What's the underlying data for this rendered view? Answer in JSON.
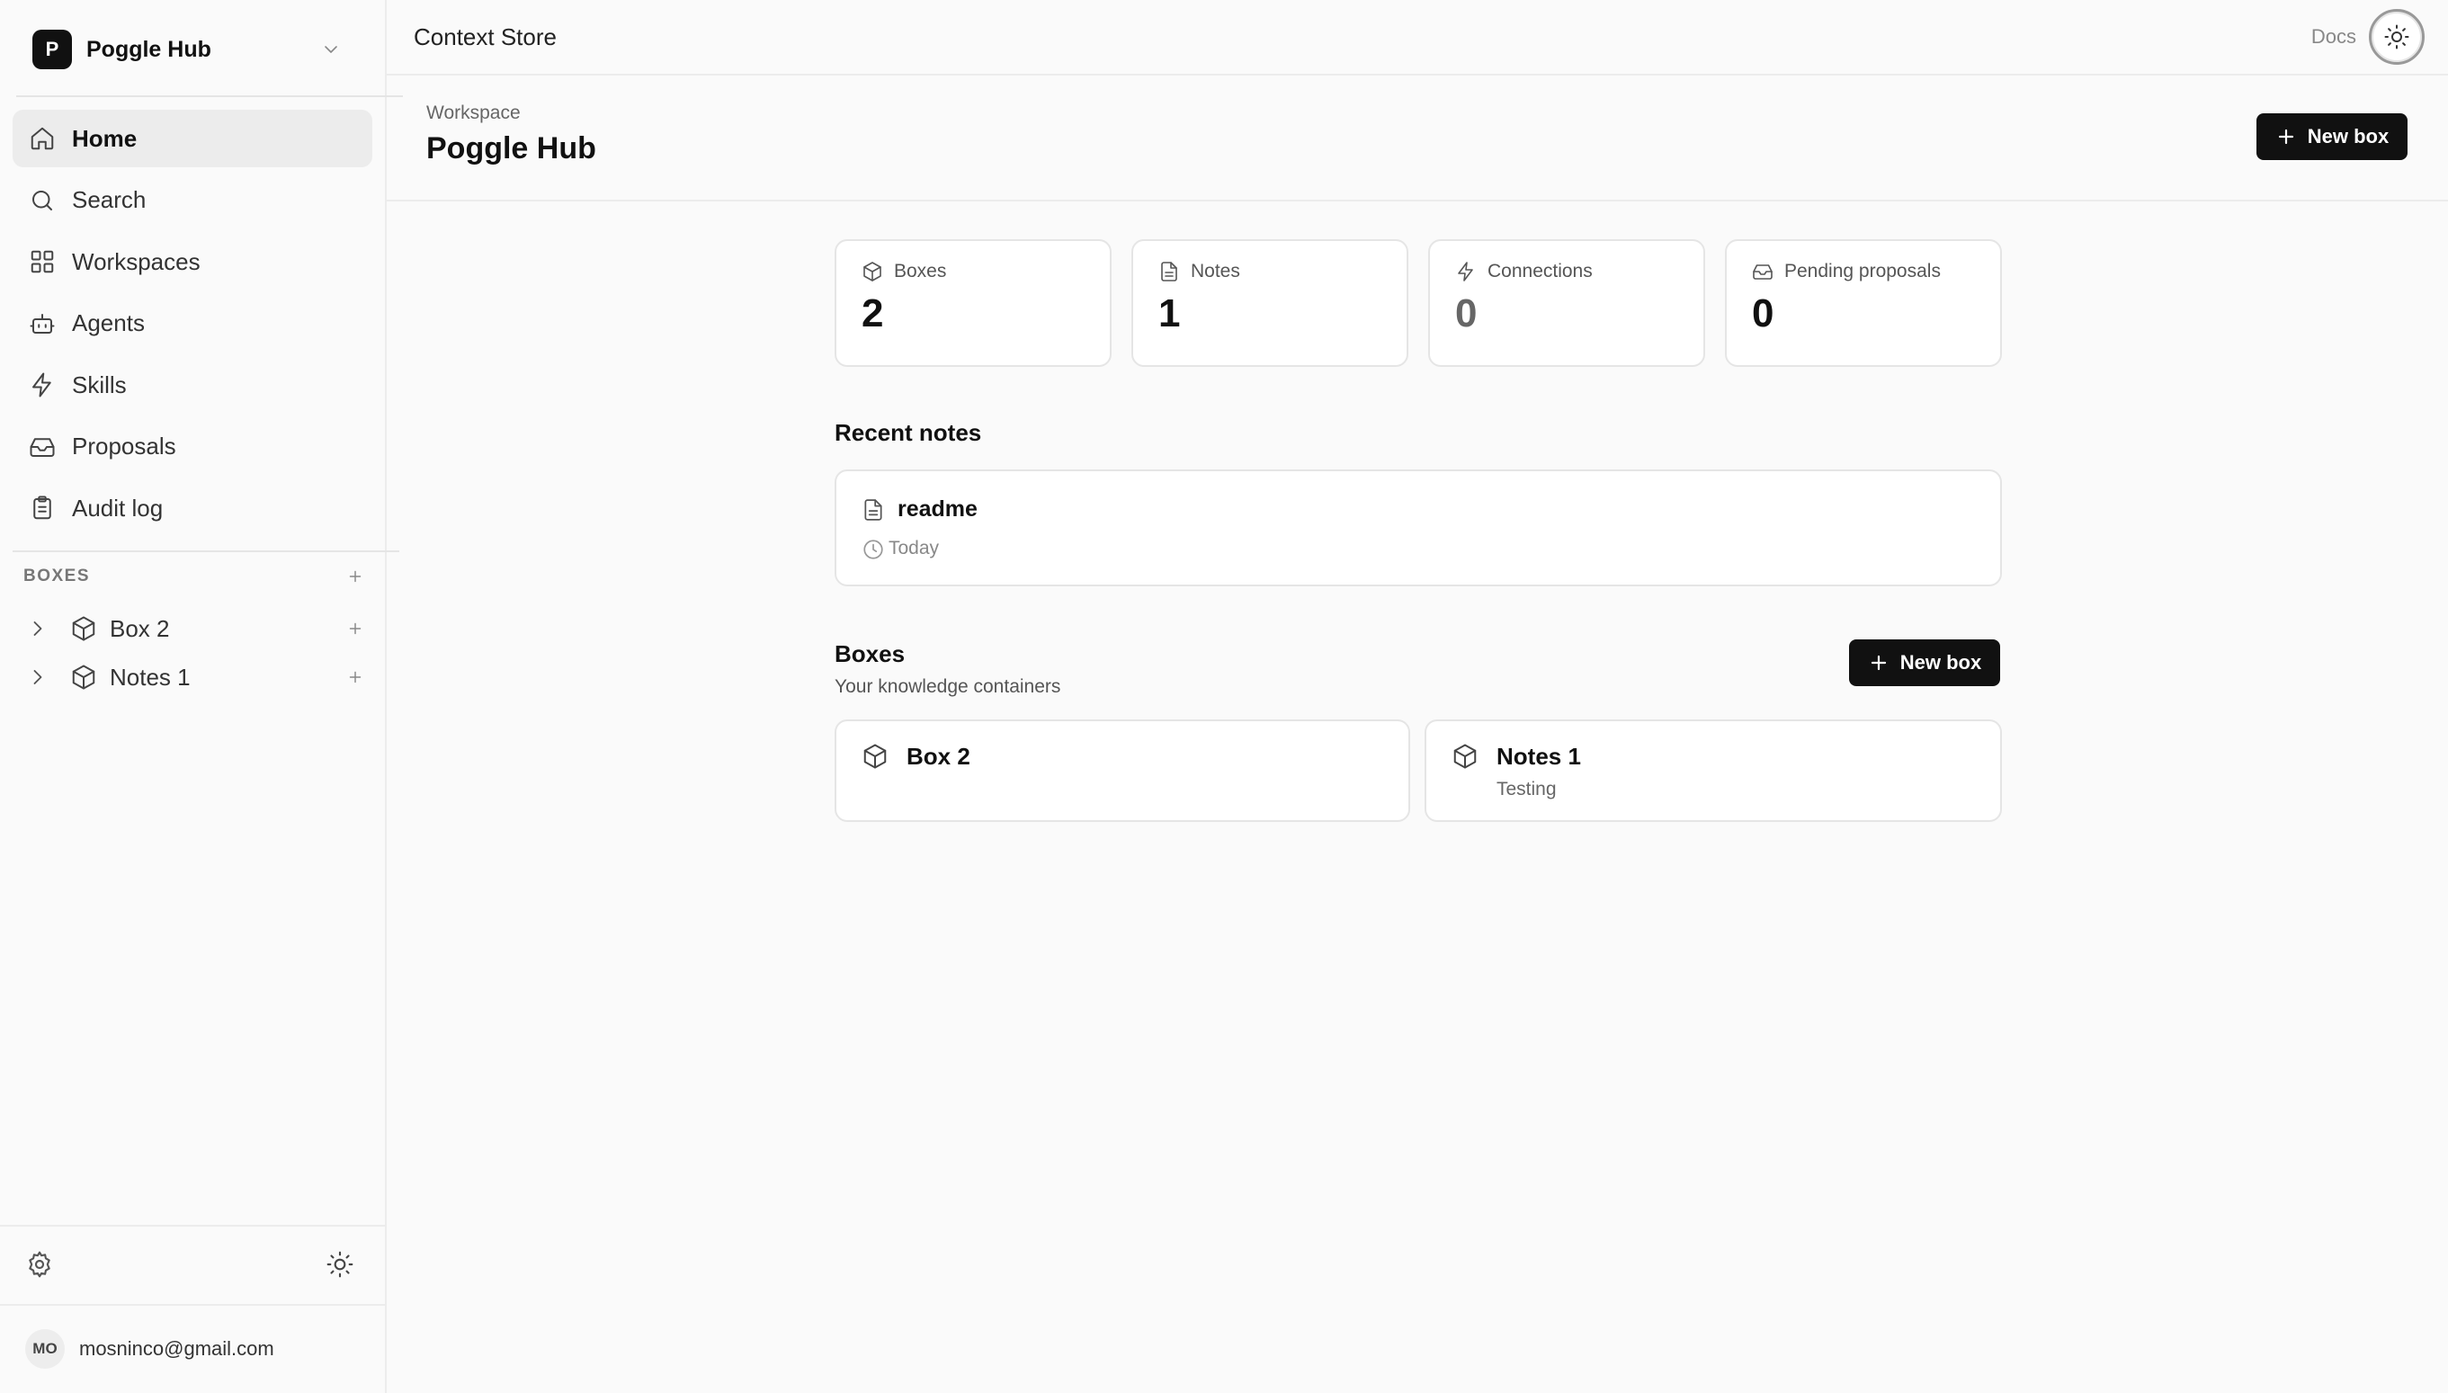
{
  "workspace": {
    "logo_letter": "P",
    "name": "Poggle Hub"
  },
  "nav": [
    {
      "label": "Home",
      "icon": "home-icon",
      "active": true
    },
    {
      "label": "Search",
      "icon": "search-icon"
    },
    {
      "label": "Workspaces",
      "icon": "grid-icon"
    },
    {
      "label": "Agents",
      "icon": "bot-icon"
    },
    {
      "label": "Skills",
      "icon": "zap-icon"
    },
    {
      "label": "Proposals",
      "icon": "inbox-icon"
    },
    {
      "label": "Audit log",
      "icon": "clipboard-icon"
    }
  ],
  "boxes_section": {
    "label": "BOXES",
    "items": [
      {
        "label": "Box 2",
        "icon": "cube-icon"
      },
      {
        "label": "Notes 1",
        "icon": "cube-icon"
      }
    ]
  },
  "user": {
    "initials": "MO",
    "email": "mosninco@gmail.com"
  },
  "topbar": {
    "title": "Context Store",
    "docs_label": "Docs"
  },
  "page": {
    "breadcrumb": "Workspace",
    "title": "Poggle Hub",
    "new_box_label": "New box"
  },
  "stats": [
    {
      "label": "Boxes",
      "value": "2",
      "icon": "cube-icon"
    },
    {
      "label": "Notes",
      "value": "1",
      "icon": "file-icon"
    },
    {
      "label": "Connections",
      "value": "0",
      "icon": "zap-icon"
    },
    {
      "label": "Pending proposals",
      "value": "0",
      "icon": "inbox-icon"
    }
  ],
  "recent_notes": {
    "title": "Recent notes",
    "items": [
      {
        "title": "readme",
        "date": "Today"
      }
    ]
  },
  "boxes": {
    "title": "Boxes",
    "subtitle": "Your knowledge containers",
    "new_box_label": "New box",
    "items": [
      {
        "name": "Box 2",
        "description": ""
      },
      {
        "name": "Notes 1",
        "description": "Testing"
      }
    ]
  },
  "colors": {
    "accent": "#111111",
    "border": "#e5e5e5",
    "background": "#fafafa"
  }
}
